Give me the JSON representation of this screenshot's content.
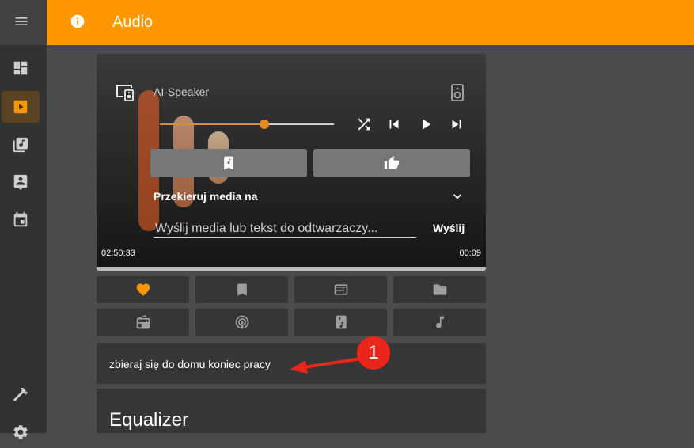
{
  "header": {
    "title": "Audio"
  },
  "player": {
    "name": "AI-Speaker",
    "volume": 0.6,
    "cast_label": "Przekieruj media na",
    "send_placeholder": "Wyślij media lub tekst do odtwarzaczy...",
    "send_label": "Wyślij",
    "time_elapsed": "02:50:33",
    "time_remaining": "00:09"
  },
  "tts": {
    "text": "zbieraj się do domu koniec pracy"
  },
  "equalizer": {
    "title": "Equalizer"
  },
  "annotation": {
    "number": "1"
  },
  "colors": {
    "accent": "#ff9800",
    "annotation": "#e8261a"
  }
}
